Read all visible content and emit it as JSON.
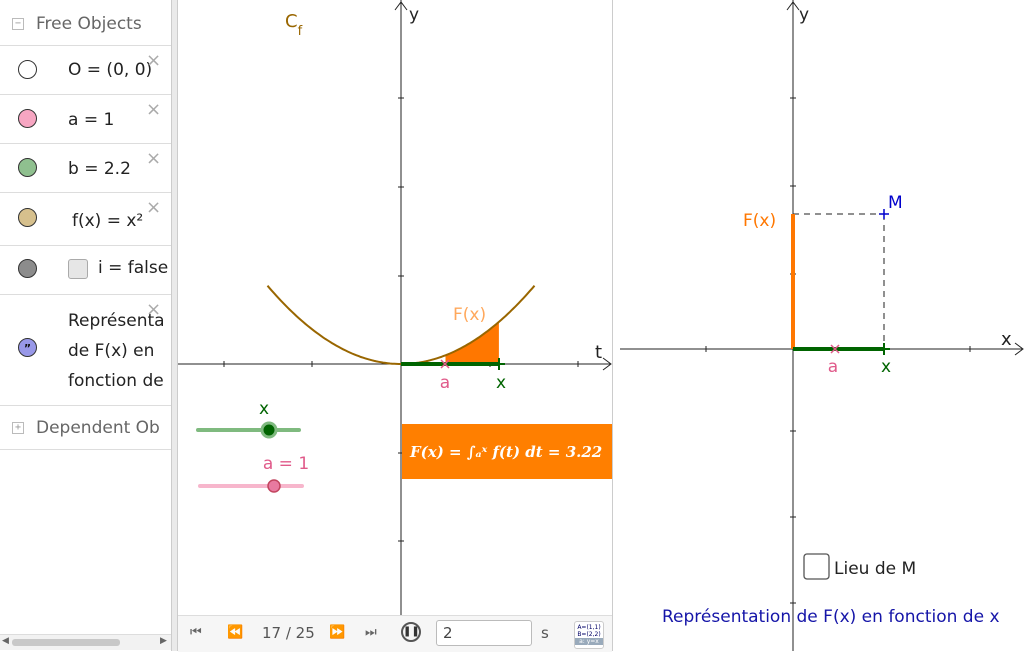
{
  "algebra": {
    "free_objects_label": "Free Objects",
    "dependent_objects_label": "Dependent Ob",
    "collapse_symbol": "−",
    "expand_symbol": "+",
    "delete_symbol": "×",
    "items": [
      {
        "text": "O = (0, 0)",
        "color": "#ffffff"
      },
      {
        "text": "a = 1",
        "color": "#f7a6c2"
      },
      {
        "text": "b = 2.2",
        "color": "#8fc08f"
      },
      {
        "text": "f(x) = x²",
        "color": "#d6c08d"
      },
      {
        "text": "i = false",
        "color": "#8c8c8c"
      },
      {
        "text_lines": [
          "Représenta",
          "de F(x) en",
          "fonction de"
        ],
        "color": "#9898e8",
        "icon": "quote-icon"
      }
    ]
  },
  "graphics1": {
    "curve_label": "C",
    "curve_subscript": "f",
    "axis_x": "t",
    "axis_y": "y",
    "point_a_label": "a",
    "point_x_label": "x",
    "area_label": "F(x)",
    "formula": "F(x) = ∫ₐˣ f(t) dt = 3.22",
    "slider_x_label": "x",
    "slider_a_label": "a = 1",
    "colors": {
      "curve": "#996600",
      "fill": "#ff7700",
      "segment": "#006400",
      "pink": "#e05a8a",
      "formula_bg": "#ff7f00",
      "slider_x": "#7fba7f",
      "slider_a": "#f7b6cc"
    }
  },
  "graphics2": {
    "axis_x": "x",
    "axis_y": "y",
    "point_M_label": "M",
    "F_label": "F(x)",
    "point_a_label": "a",
    "point_x_label": "x",
    "checkbox_label": "Lieu de M",
    "caption": "Représentation de F(x) en fonction de x",
    "colors": {
      "F_segment": "#ff7700",
      "segment": "#006400",
      "M": "#0000cc",
      "caption": "#1515a8"
    }
  },
  "animation": {
    "frame": "17 / 25",
    "speed_value": "2",
    "speed_unit": "s",
    "first_icon": "⏮",
    "prev_icon": "⏪",
    "next_icon": "⏩",
    "last_icon": "⏭",
    "pause_icon": "❚❚",
    "keyboard_icon_lines": [
      "A=(1,1)",
      "B=(2,2)",
      "a: y=x"
    ]
  },
  "function": {
    "a": 1,
    "x": 2.2,
    "F_of_x": 3.22
  }
}
